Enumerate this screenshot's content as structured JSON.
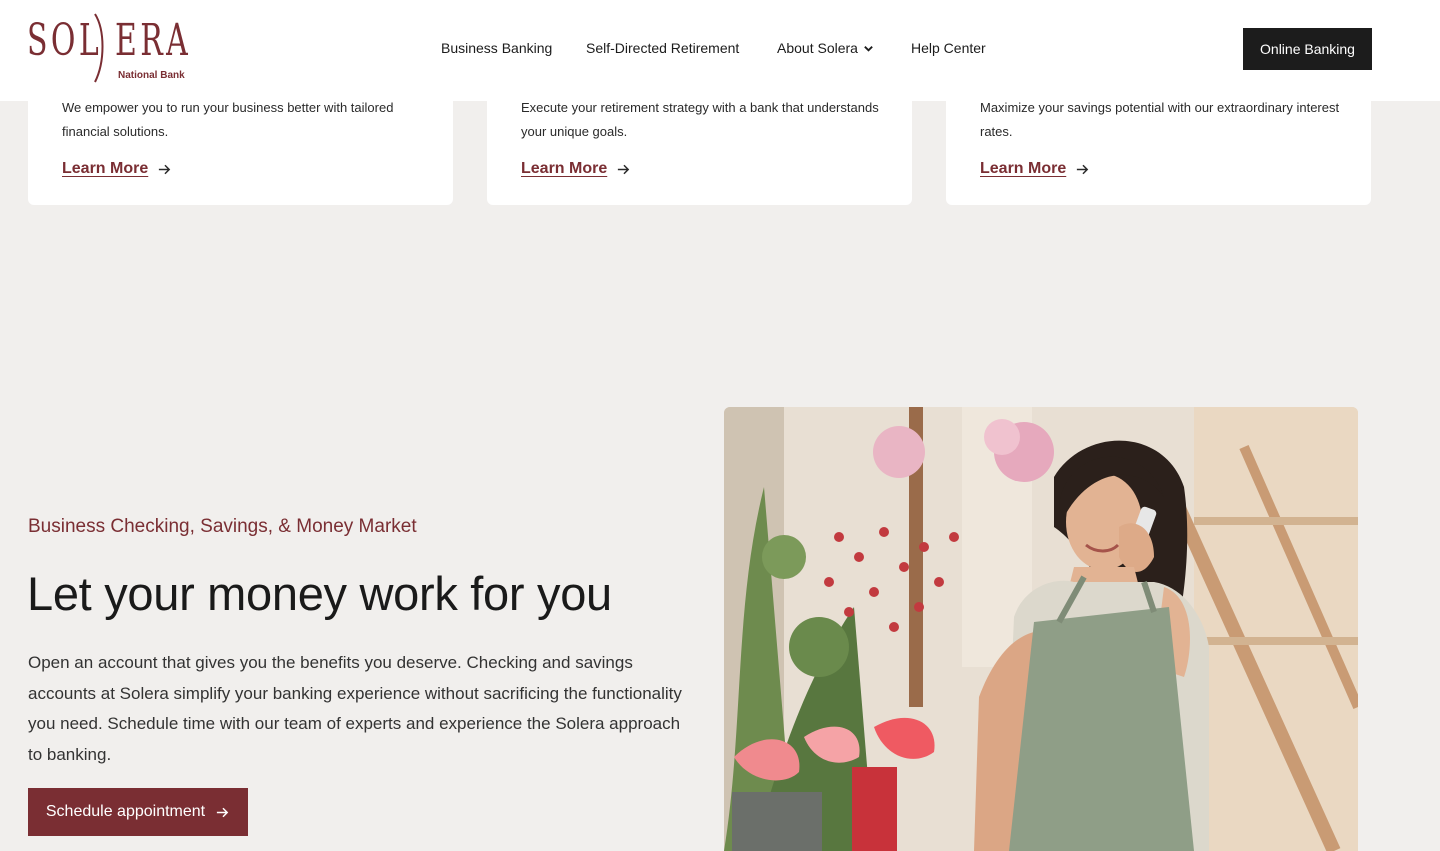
{
  "brand": {
    "logo_text": "SOLERA",
    "logo_subtitle": "National Bank",
    "color": "#7a2e33"
  },
  "nav": {
    "items": [
      {
        "label": "Business Banking"
      },
      {
        "label": "Self-Directed Retirement"
      },
      {
        "label": "About Solera",
        "has_dropdown": true
      },
      {
        "label": "Help Center"
      }
    ],
    "cta_label": "Online Banking"
  },
  "cards": [
    {
      "text": "We empower you to run your business better with tailored financial solutions.",
      "link": "Learn More"
    },
    {
      "text": "Execute your retirement strategy with a bank that understands your unique goals.",
      "link": "Learn More"
    },
    {
      "text": "Maximize your savings potential with our extraordinary interest rates.",
      "link": "Learn More"
    }
  ],
  "feature": {
    "eyebrow": "Business Checking, Savings, & Money Market",
    "headline": "Let your money work for you",
    "body": "Open an account that gives you the benefits you deserve. Checking and savings accounts at Solera simplify your banking experience without sacrificing the functionality you need. Schedule time with our team of experts and experience the Solera approach to banking.",
    "cta_label": "Schedule appointment"
  },
  "icons": {
    "arrow": "arrow-right-icon",
    "chevron": "chevron-down-icon"
  }
}
